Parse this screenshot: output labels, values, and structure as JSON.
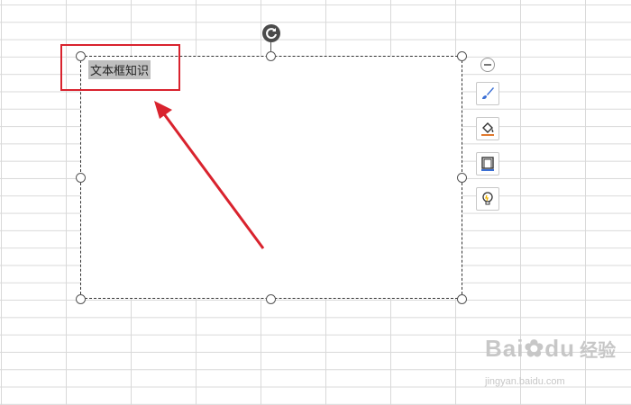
{
  "textbox": {
    "text": "文本框知识"
  },
  "toolbar": {
    "collapse_icon": "minus-circle-icon",
    "items": [
      {
        "name": "shape-style",
        "icon": "brush-icon"
      },
      {
        "name": "fill",
        "icon": "paint-bucket-icon"
      },
      {
        "name": "outline",
        "icon": "outline-icon"
      },
      {
        "name": "smart",
        "icon": "lightbulb-icon"
      }
    ]
  },
  "annotation": {
    "arrow_color": "#d9232e"
  },
  "watermark": {
    "logo": "Bai",
    "logo_mid": "du",
    "cn": "经验",
    "url": "jingyan.baidu.com"
  },
  "colors": {
    "grid": "#d9d9d9",
    "accent_red": "#d9232e",
    "brush_blue": "#3b6fd4",
    "fill_orange": "#e07a2e"
  }
}
